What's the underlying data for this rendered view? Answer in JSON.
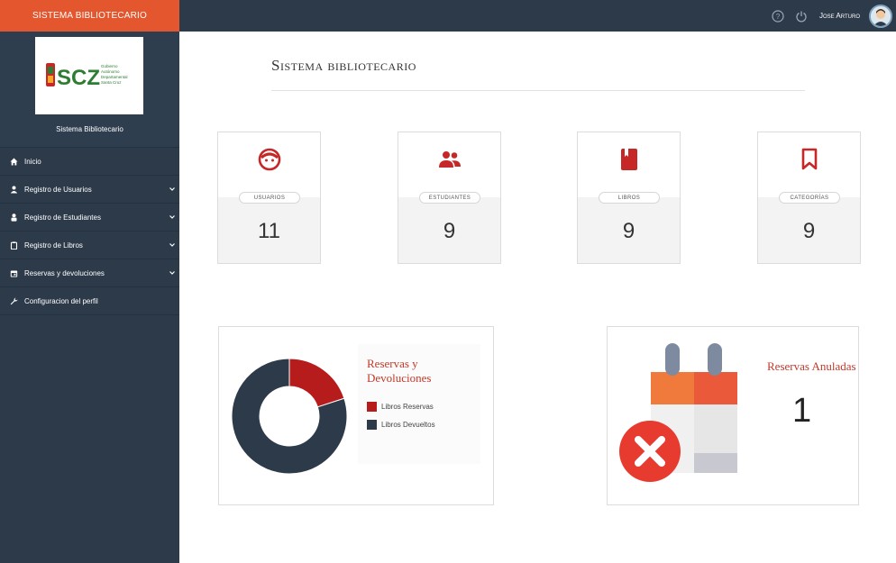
{
  "header": {
    "brand": "SISTEMA BIBLIOTECARIO",
    "username": "Jose Arturo",
    "icons": [
      "help-icon",
      "power-icon"
    ]
  },
  "sidebar": {
    "logo": {
      "letters": "SCZ",
      "lines": [
        "Gobierno",
        "Autónomo",
        "Departamental",
        "Santa Cruz"
      ]
    },
    "title": "Sistema Bibliotecario",
    "items": [
      {
        "label": "Inicio",
        "icon": "home-icon",
        "expandable": false
      },
      {
        "label": "Registro de Usuarios",
        "icon": "user-icon",
        "expandable": true
      },
      {
        "label": "Registro de Estudiantes",
        "icon": "student-icon",
        "expandable": true
      },
      {
        "label": "Registro de Libros",
        "icon": "clipboard-icon",
        "expandable": true
      },
      {
        "label": "Reservas y devoluciones",
        "icon": "calendar-icon",
        "expandable": true
      },
      {
        "label": "Configuracion del perfil",
        "icon": "wrench-icon",
        "expandable": false
      }
    ]
  },
  "main": {
    "title": "Sistema bibliotecario",
    "cards": [
      {
        "label": "Usuarios",
        "value": "11",
        "icon": "face-icon"
      },
      {
        "label": "Estudiantes",
        "value": "9",
        "icon": "users-icon"
      },
      {
        "label": "Libros",
        "value": "9",
        "icon": "book-icon"
      },
      {
        "label": "Categorías",
        "value": "9",
        "icon": "bookmark-icon"
      }
    ],
    "reservas_panel": {
      "title": "Reservas y Devoluciones",
      "legend": [
        {
          "label": "Libros Reservas",
          "color": "#b71c1c"
        },
        {
          "label": "Libros Devueltos",
          "color": "#2d3a4a"
        }
      ]
    },
    "anuladas_panel": {
      "title": "Reservas Anuladas",
      "value": "1"
    }
  },
  "colors": {
    "accent": "#e4562e",
    "dark": "#2d3a4a",
    "red": "#b71c1c"
  },
  "chart_data": {
    "type": "pie",
    "title": "Reservas y Devoluciones",
    "categories": [
      "Libros Reservas",
      "Libros Devueltos"
    ],
    "values": [
      20,
      80
    ],
    "colors": [
      "#b71c1c",
      "#2d3a4a"
    ],
    "donut": true,
    "legend": "right"
  }
}
